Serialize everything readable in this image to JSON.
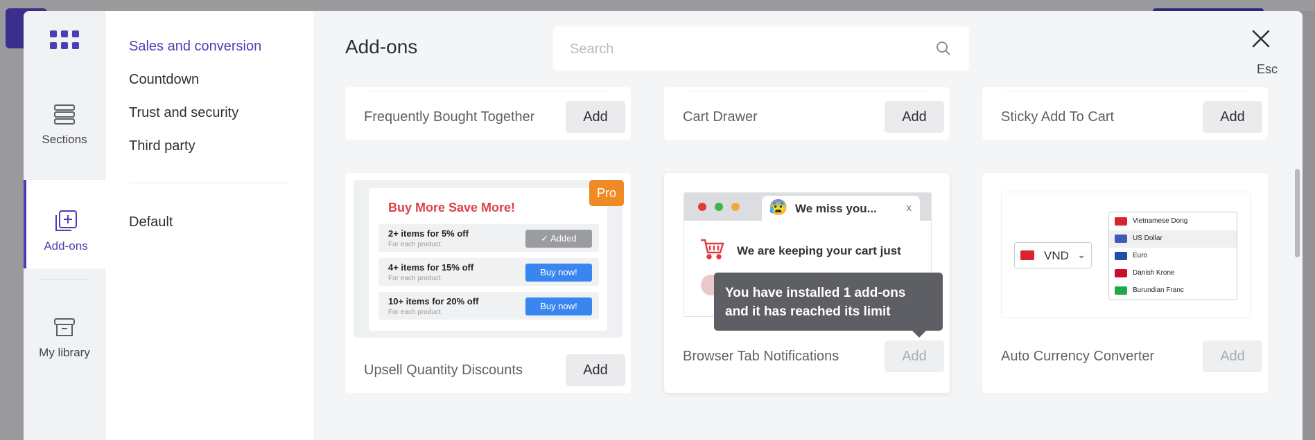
{
  "rail": {
    "items": [
      {
        "label": "Sections",
        "icon": "stack-icon"
      },
      {
        "label": "Add-ons",
        "icon": "plus-square-icon"
      },
      {
        "label": "My library",
        "icon": "archive-icon"
      }
    ]
  },
  "categories": {
    "items": [
      "Sales and conversion",
      "Countdown",
      "Trust and security",
      "Third party"
    ],
    "default": "Default"
  },
  "main": {
    "title": "Add-ons",
    "search_placeholder": "Search",
    "esc_label": "Esc"
  },
  "cards": [
    {
      "name": "Frequently Bought Together",
      "button": "Add"
    },
    {
      "name": "Cart Drawer",
      "button": "Add"
    },
    {
      "name": "Sticky Add To Cart",
      "button": "Add"
    },
    {
      "name": "Upsell Quantity Discounts",
      "button": "Add",
      "badge": "Pro"
    },
    {
      "name": "Browser Tab Notifications",
      "button": "Add"
    },
    {
      "name": "Auto Currency Converter",
      "button": "Add"
    }
  ],
  "upsell_preview": {
    "title": "Buy More Save More!",
    "tiers": [
      {
        "text": "2+ items for 5% off",
        "sub": "For  each product.",
        "button": "✓ Added"
      },
      {
        "text": "4+ items for 15% off",
        "sub": "For  each product.",
        "button": "Buy now!"
      },
      {
        "text": "10+ items for 20% off",
        "sub": "For  each product.",
        "button": "Buy now!"
      }
    ]
  },
  "browser_tab_preview": {
    "tab_emoji": "😰",
    "tab_title": "We miss you...",
    "tab_close": "x",
    "message": "We are keeping your cart just"
  },
  "tooltip": {
    "line1": "You have installed 1 add-ons",
    "line2": "and it has reached its limit"
  },
  "currency_preview": {
    "selected": "VND",
    "options": [
      {
        "name": "Vietnamese Dong",
        "flag": "#d8242e"
      },
      {
        "name": "US Dollar",
        "flag": "#3b5bb5"
      },
      {
        "name": "Euro",
        "flag": "#1f4fa8"
      },
      {
        "name": "Danish Krone",
        "flag": "#c8102e"
      },
      {
        "name": "Burundian Franc",
        "flag": "#1ea84b"
      }
    ]
  },
  "colors": {
    "accent": "#4a3fb5",
    "pro_badge": "#f08a24",
    "upsell_title": "#e04048",
    "buy_button": "#3a86f0"
  }
}
